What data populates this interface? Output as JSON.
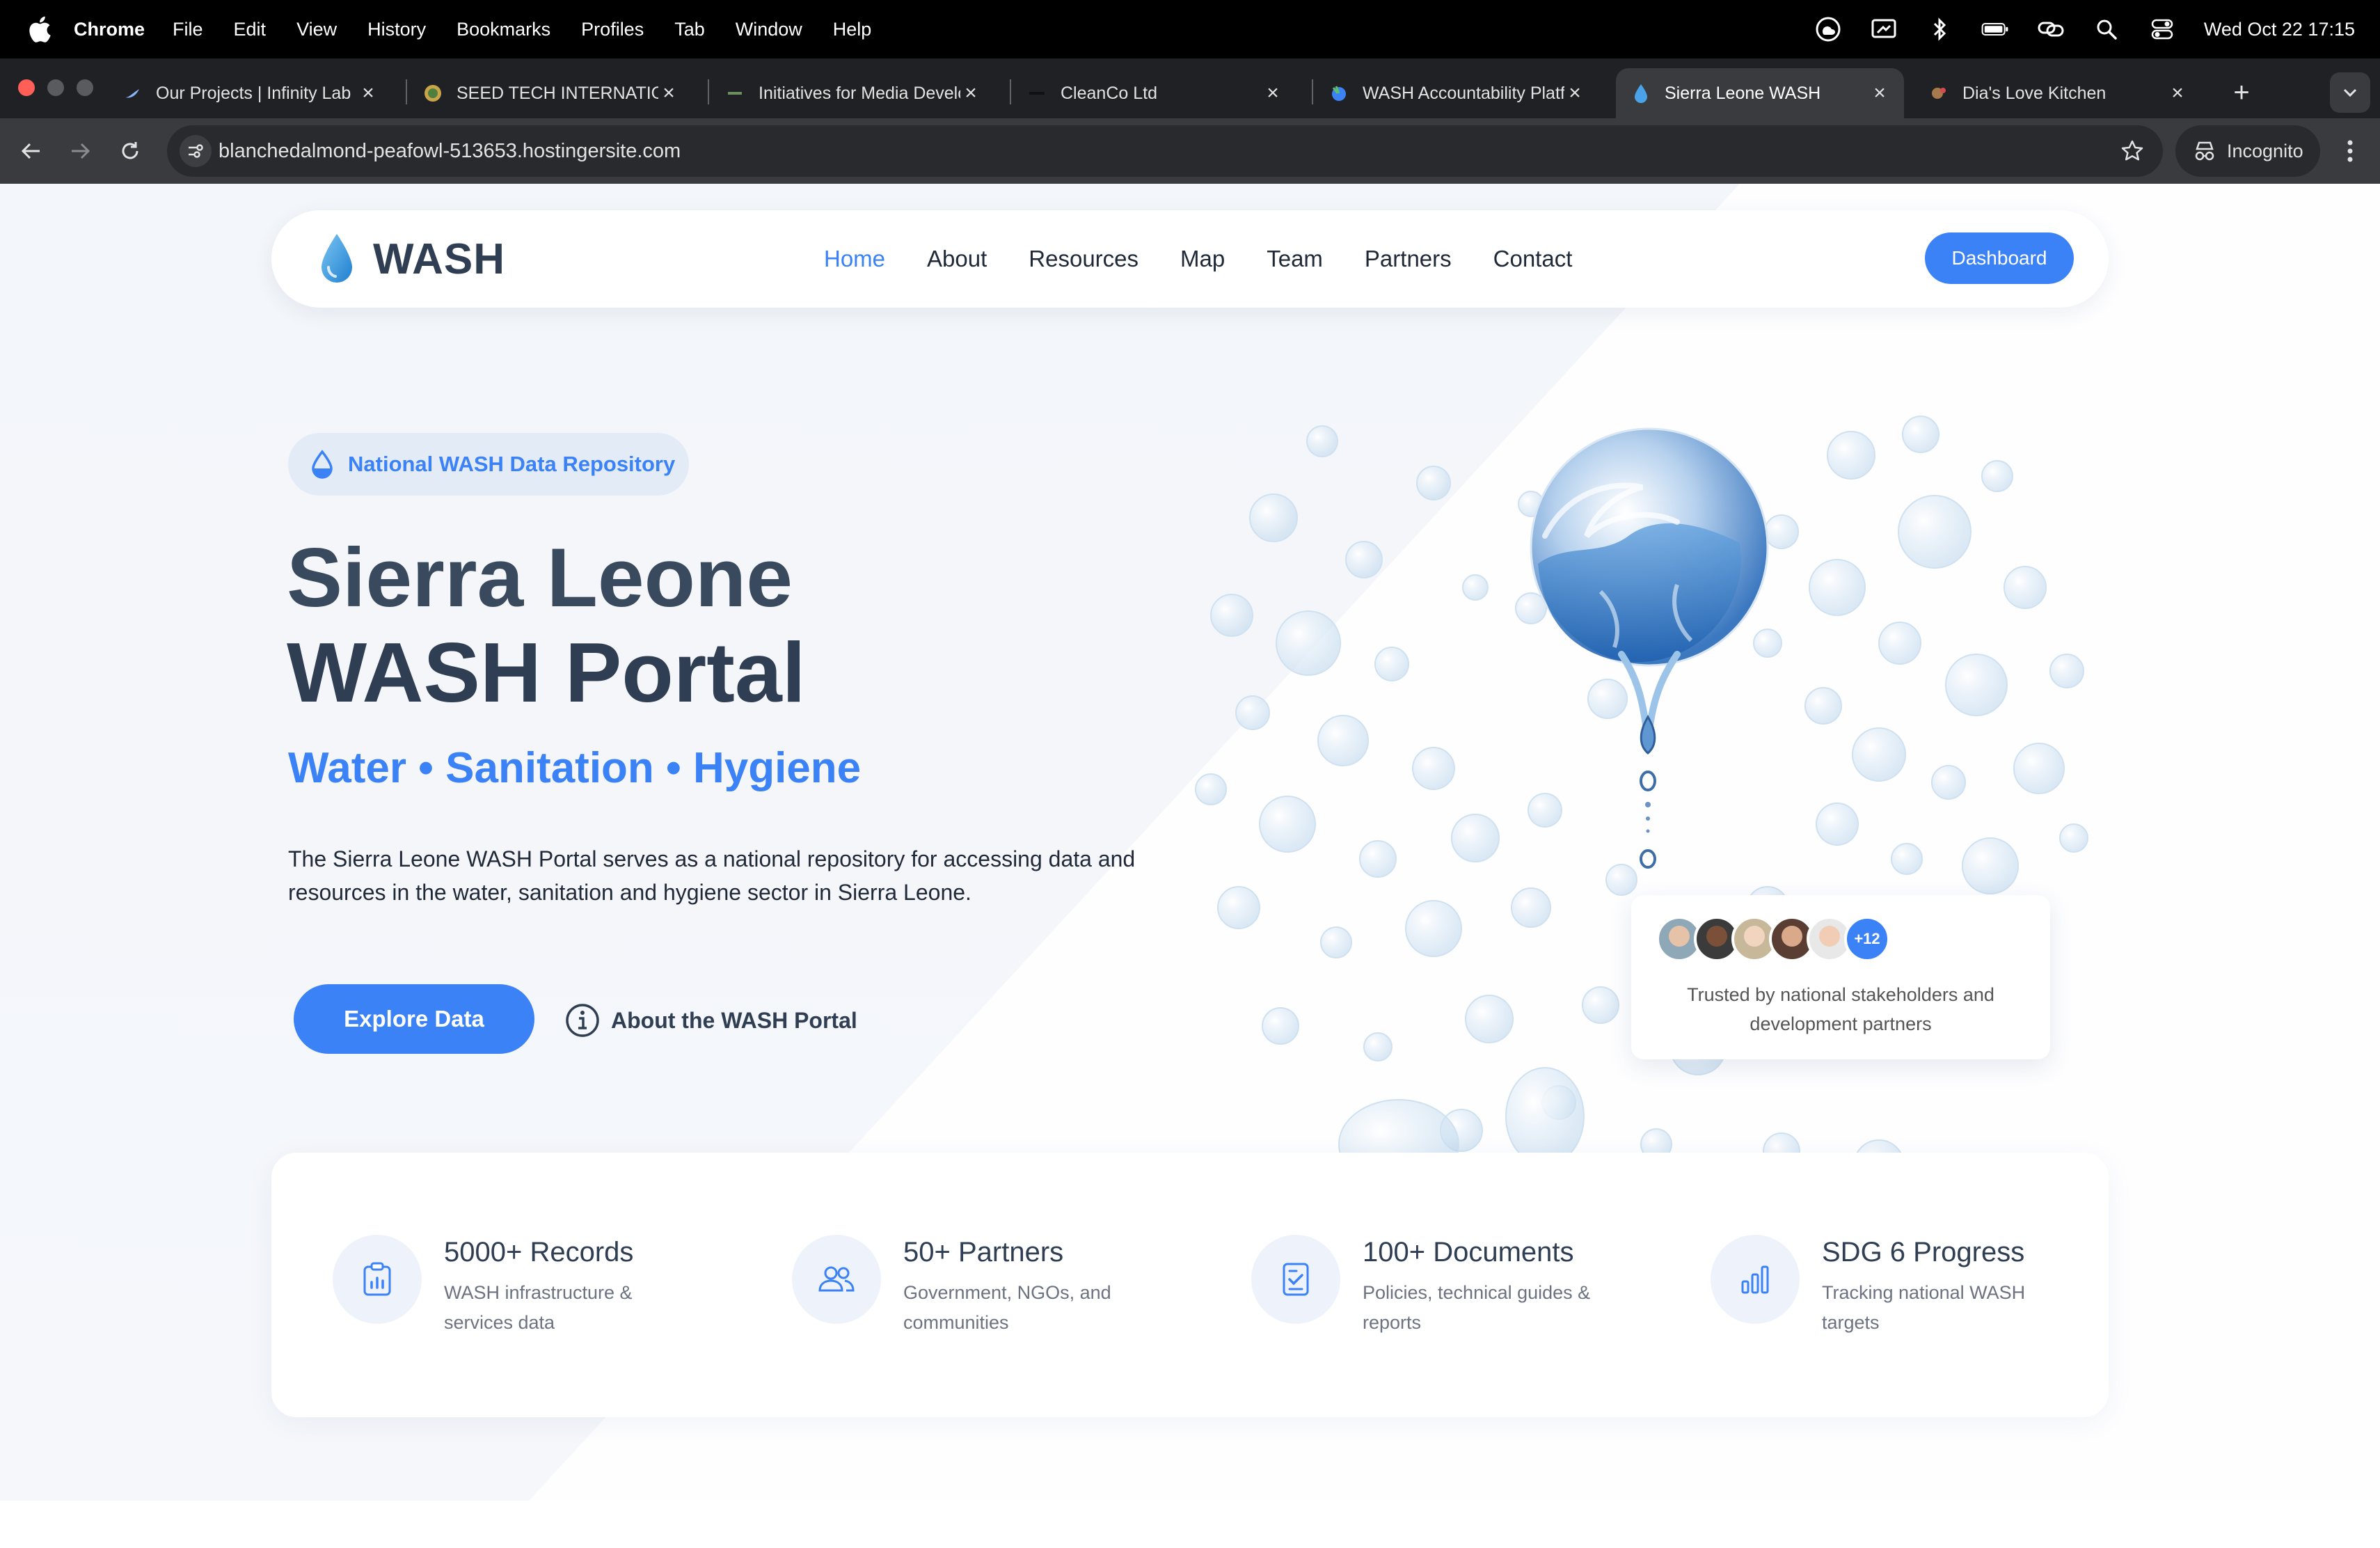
{
  "menubar": {
    "app": "Chrome",
    "items": [
      "File",
      "Edit",
      "View",
      "History",
      "Bookmarks",
      "Profiles",
      "Tab",
      "Window",
      "Help"
    ],
    "clock": "Wed Oct 22  17:15"
  },
  "tabs": [
    {
      "label": "Our Projects | Infinity Lab"
    },
    {
      "label": "SEED TECH INTERNATIONAL"
    },
    {
      "label": "Initiatives for Media Development"
    },
    {
      "label": "CleanCo Ltd"
    },
    {
      "label": "WASH Accountability Platform"
    },
    {
      "label": "Sierra Leone WASH",
      "active": true
    },
    {
      "label": "Dia's Love Kitchen"
    }
  ],
  "toolbar": {
    "url": "blanchedalmond-peafowl-513653.hostingersite.com",
    "incognito_label": "Incognito"
  },
  "site": {
    "logo_text": "WASH",
    "nav": [
      "Home",
      "About",
      "Resources",
      "Map",
      "Team",
      "Partners",
      "Contact"
    ],
    "active_nav": "Home",
    "dashboard_label": "Dashboard"
  },
  "hero": {
    "badge": "National WASH Data Repository",
    "title_line1": "Sierra Leone",
    "title_line2": "WASH Portal",
    "tagline": "Water • Sanitation • Hygiene",
    "intro": "The Sierra Leone WASH Portal serves as a national repository for accessing data and resources in the water, sanitation and hygiene sector in Sierra Leone.",
    "explore_label": "Explore Data",
    "about_label": "About the WASH Portal"
  },
  "trust": {
    "more_count": "+12",
    "text": "Trusted by national stakeholders and development partners"
  },
  "stats": [
    {
      "title": "5000+ Records",
      "desc": "WASH infrastructure & services data",
      "icon": "clipboard-chart-icon"
    },
    {
      "title": "50+ Partners",
      "desc": "Government, NGOs, and communities",
      "icon": "users-icon"
    },
    {
      "title": "100+ Documents",
      "desc": "Policies, technical guides & reports",
      "icon": "document-check-icon"
    },
    {
      "title": "SDG 6 Progress",
      "desc": "Tracking national WASH targets",
      "icon": "bar-chart-icon"
    }
  ],
  "colors": {
    "accent": "#3b82f6",
    "heading": "#2f3e52",
    "hero_bg": "#f3f6fa"
  }
}
